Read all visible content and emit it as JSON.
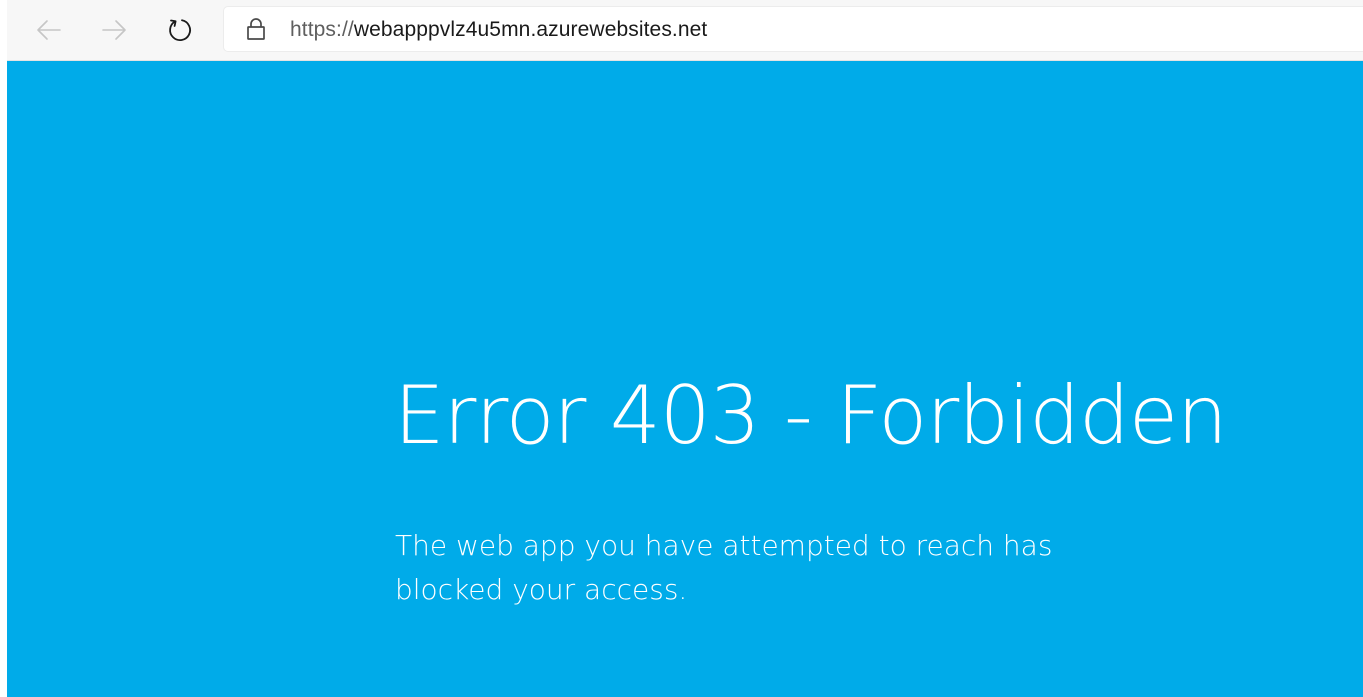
{
  "browser": {
    "url": {
      "scheme": "https://",
      "host": "webapppvlz4u5mn.azurewebsites.net"
    },
    "icons": {
      "back": "arrow-left-icon",
      "forward": "arrow-right-icon",
      "refresh": "refresh-icon",
      "lock": "lock-icon"
    }
  },
  "page": {
    "title": "Error 403 - Forbidden",
    "message": "The web app you have attempted to reach has blocked your access.",
    "background_color": "#00abe9",
    "text_color": "#ffffff"
  }
}
